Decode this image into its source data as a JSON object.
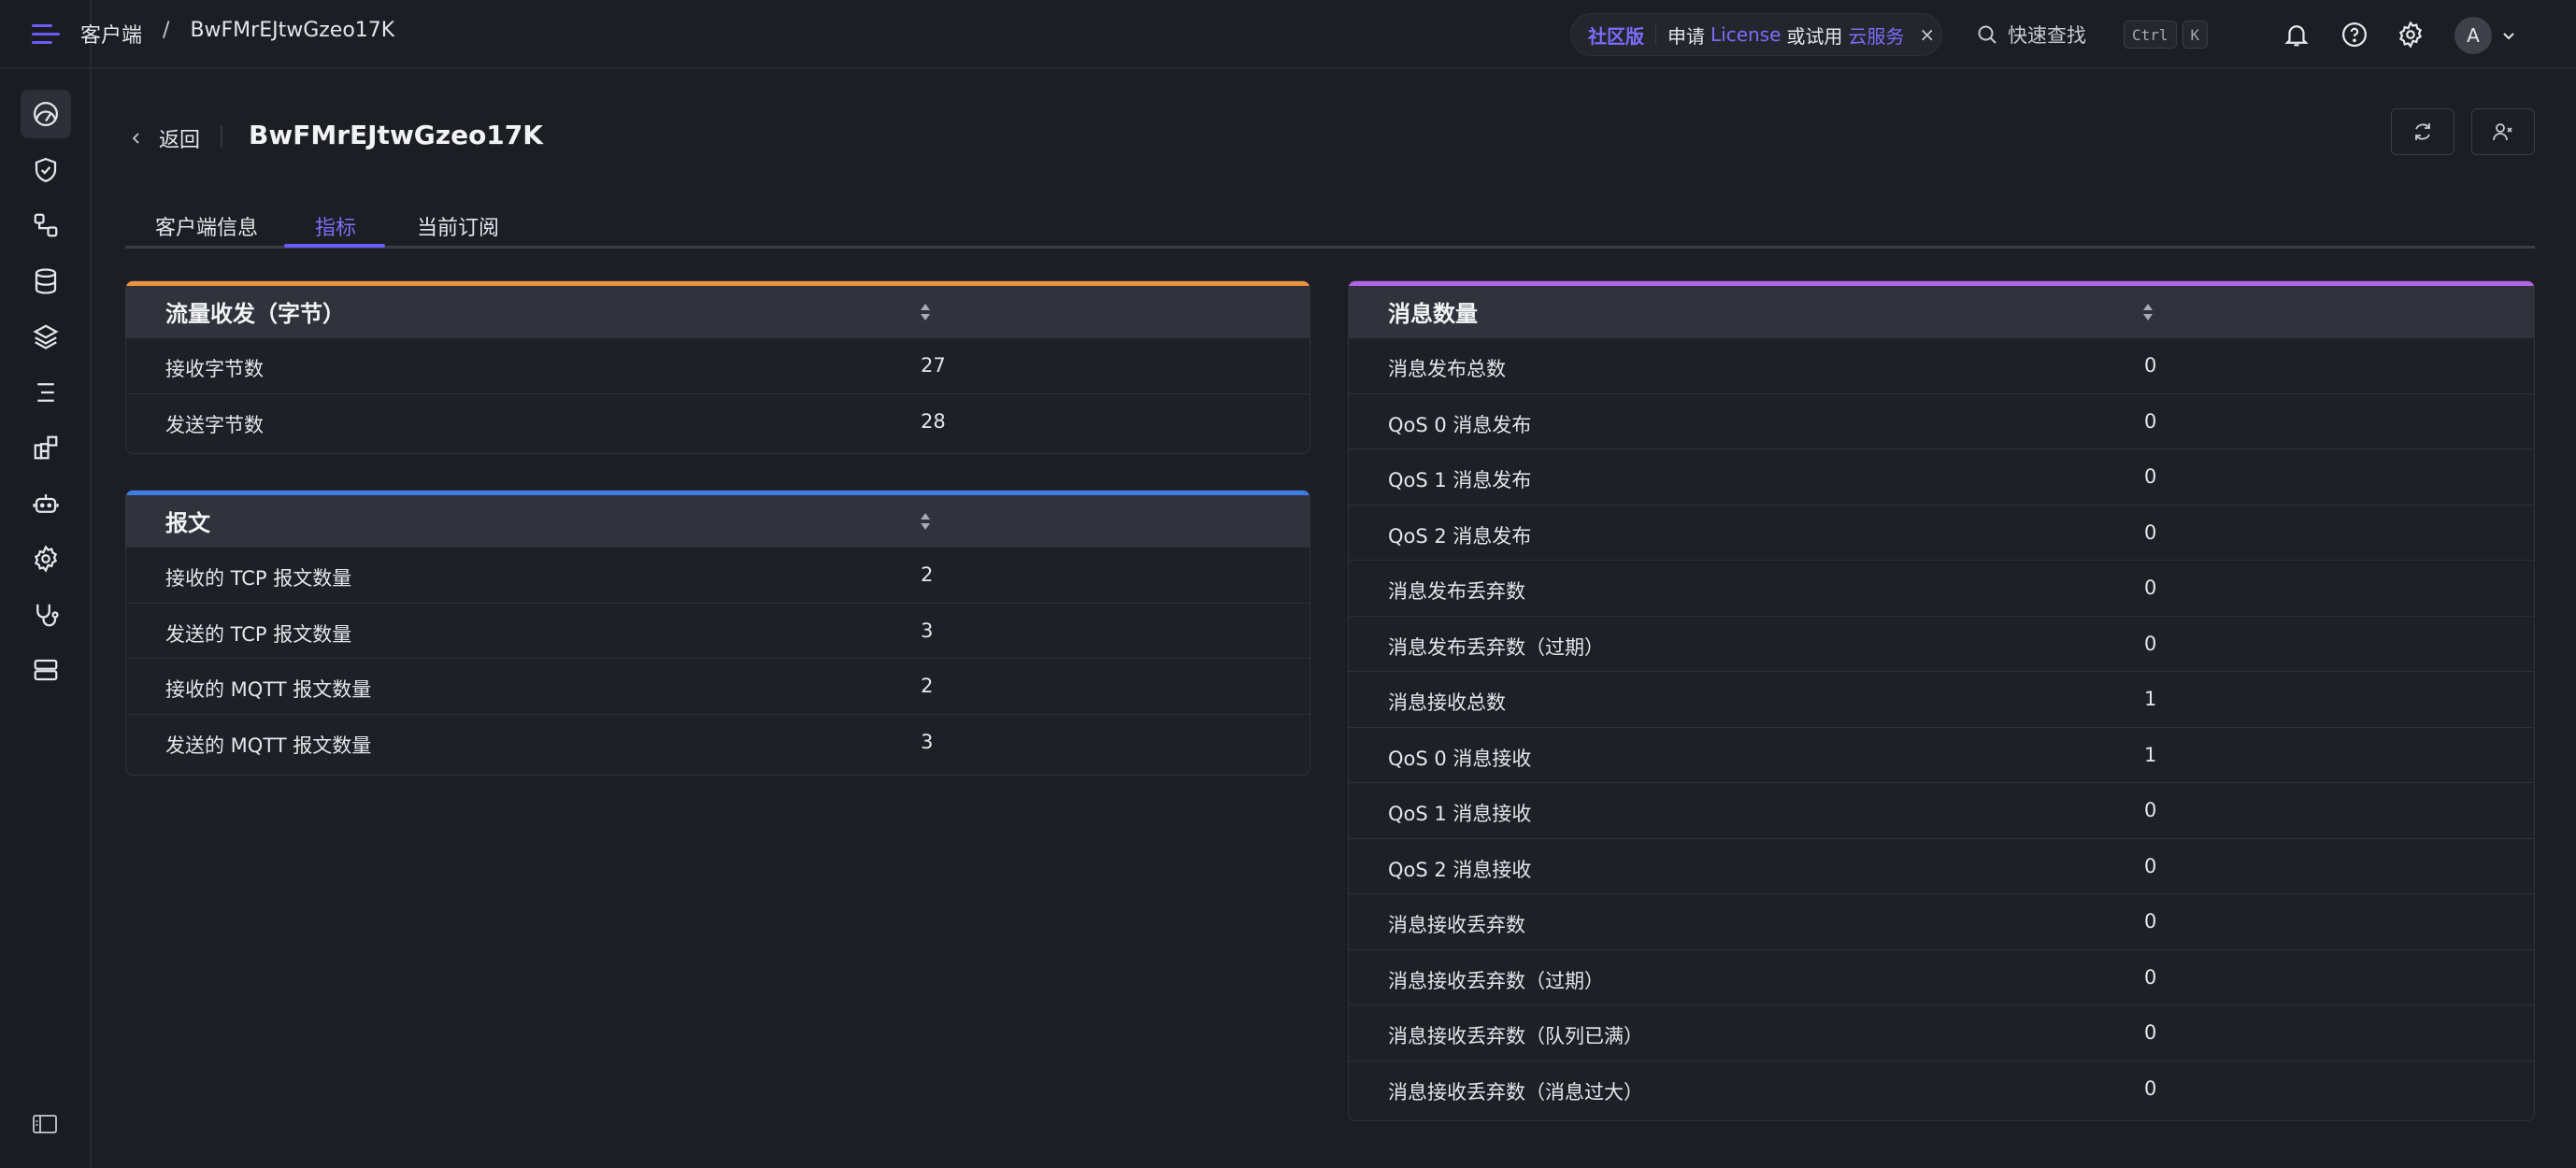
{
  "breadcrumb": {
    "section": "客户端",
    "separator": "/",
    "current": "BwFMrEJtwGzeo17K"
  },
  "promo": {
    "badge": "社区版",
    "text_prefix": "申请",
    "license_link": "License",
    "text_middle": "或试用",
    "cloud_link": "云服务",
    "close": "×"
  },
  "search": {
    "placeholder": "快速查找",
    "key1": "Ctrl",
    "key2": "K"
  },
  "user": {
    "avatar_initial": "A"
  },
  "page": {
    "back_label": "返回",
    "title": "BwFMrEJtwGzeo17K"
  },
  "tabs": [
    {
      "label": "客户端信息"
    },
    {
      "label": "指标",
      "active": true
    },
    {
      "label": "当前订阅"
    }
  ],
  "traffic": {
    "title": "流量收发（字节）",
    "accent_color": "#f0923f",
    "rows": [
      {
        "label": "接收字节数",
        "value": "27"
      },
      {
        "label": "发送字节数",
        "value": "28"
      }
    ]
  },
  "packets": {
    "title": "报文",
    "accent_color": "#3d7de8",
    "rows": [
      {
        "label": "接收的 TCP 报文数量",
        "value": "2"
      },
      {
        "label": "发送的 TCP 报文数量",
        "value": "3"
      },
      {
        "label": "接收的 MQTT 报文数量",
        "value": "2"
      },
      {
        "label": "发送的 MQTT 报文数量",
        "value": "3"
      }
    ]
  },
  "messages": {
    "title": "消息数量",
    "accent_color": "#b464e8",
    "rows": [
      {
        "label": "消息发布总数",
        "value": "0"
      },
      {
        "label": "QoS 0 消息发布",
        "value": "0"
      },
      {
        "label": "QoS 1 消息发布",
        "value": "0"
      },
      {
        "label": "QoS 2 消息发布",
        "value": "0"
      },
      {
        "label": "消息发布丢弃数",
        "value": "0"
      },
      {
        "label": "消息发布丢弃数（过期）",
        "value": "0"
      },
      {
        "label": "消息接收总数",
        "value": "1"
      },
      {
        "label": "QoS 0 消息接收",
        "value": "1"
      },
      {
        "label": "QoS 1 消息接收",
        "value": "0"
      },
      {
        "label": "QoS 2 消息接收",
        "value": "0"
      },
      {
        "label": "消息接收丢弃数",
        "value": "0"
      },
      {
        "label": "消息接收丢弃数（过期）",
        "value": "0"
      },
      {
        "label": "消息接收丢弃数（队列已满）",
        "value": "0"
      },
      {
        "label": "消息接收丢弃数（消息过大）",
        "value": "0"
      }
    ]
  },
  "colors": {
    "primary": "#6a5cf5",
    "background": "#1c1e24",
    "card_header": "#30333b"
  },
  "icons": {
    "sidebar": [
      "dashboard-icon",
      "shield-check-icon",
      "flow-icon",
      "database-icon",
      "layers-icon",
      "list-icon",
      "plugins-icon",
      "robot-icon",
      "gear-icon",
      "stethoscope-icon",
      "server-icon"
    ],
    "topbar": [
      "bell-icon",
      "help-icon",
      "gear-icon",
      "chevron-down-icon"
    ],
    "header": [
      "refresh-icon",
      "kick-user-icon"
    ]
  }
}
